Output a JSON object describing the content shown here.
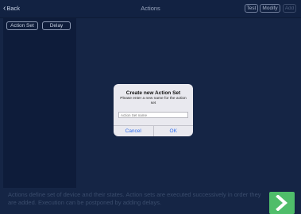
{
  "nav": {
    "back_label": "Back",
    "title": "Actions",
    "buttons": {
      "test": "Test",
      "modify": "Modify",
      "add": "Add"
    }
  },
  "sidebar": {
    "tabs": [
      {
        "label": "Action Set"
      },
      {
        "label": "Delay"
      }
    ]
  },
  "dialog": {
    "title": "Create new Action Set",
    "message": "Please enter a new name for the action set",
    "input_placeholder": "Action Set name",
    "input_value": "",
    "cancel_label": "Cancel",
    "ok_label": "OK"
  },
  "footer": {
    "text": "Actions define set of device and their states. Action sets are executed successively in order they are added. Execution can be postponed by adding delays."
  },
  "colors": {
    "background": "#152545",
    "accent_green": "#4fbd6a",
    "dialog_button": "#2f6ef0"
  },
  "icons": {
    "back": "chevron-left-icon",
    "next": "chevron-right-icon"
  }
}
